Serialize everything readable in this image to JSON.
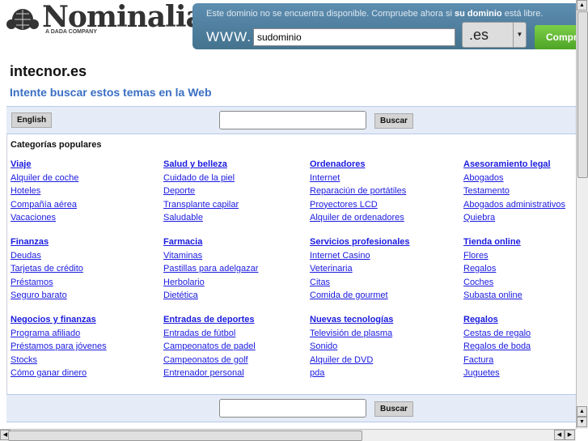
{
  "logo": {
    "name": "Nominalia",
    "tagline": "A DADA COMPANY"
  },
  "domain_box": {
    "message": "Este dominio no se encuentra disponible. Compruebe ahora si ",
    "message_bold": "su dominio",
    "message_end": " está libre.",
    "prefix": "WWW.",
    "input_value": "sudominio",
    "tld": ".es",
    "check_button": "Comprobar"
  },
  "page": {
    "title": "intecnor.es",
    "subtitle": "Intente buscar estos temas en la Web"
  },
  "search": {
    "language_button": "English",
    "search_button": "Buscar"
  },
  "categories": {
    "heading": "Categorías populares",
    "columns": [
      [
        {
          "title": "Viaje",
          "items": [
            "Alquiler de coche",
            "Hoteles",
            "Compañía aérea",
            "Vacaciones"
          ]
        },
        {
          "title": "Finanzas",
          "items": [
            "Deudas",
            "Tarjetas de crédito",
            "Préstamos",
            "Seguro barato"
          ]
        },
        {
          "title": "Negocios y finanzas",
          "items": [
            "Programa afiliado",
            "Préstamos para jóvenes",
            "Stocks",
            "Cómo ganar dinero"
          ]
        }
      ],
      [
        {
          "title": "Salud y belleza",
          "items": [
            "Cuidado de la piel",
            "Deporte",
            "Transplante capilar",
            "Saludable"
          ]
        },
        {
          "title": "Farmacia",
          "items": [
            "Vitaminas",
            "Pastillas para adelgazar",
            "Herbolario",
            "Dietética"
          ]
        },
        {
          "title": "Entradas de deportes",
          "items": [
            "Entradas de fútbol",
            "Campeonatos de padel",
            "Campeonatos de golf",
            "Entrenador personal"
          ]
        }
      ],
      [
        {
          "title": "Ordenadores",
          "items": [
            "Internet",
            "Reparaciún de portátiles",
            "Proyectores LCD",
            "Alquiler de ordenadores"
          ]
        },
        {
          "title": "Servicios profesionales",
          "items": [
            "Internet Casino",
            "Veterinaria",
            "Citas",
            "Comida de gourmet"
          ]
        },
        {
          "title": "Nuevas tecnologías",
          "items": [
            "Televisión de plasma",
            "Sonido",
            "Alquiler de DVD",
            "pda"
          ]
        }
      ],
      [
        {
          "title": "Asesoramiento legal",
          "items": [
            "Abogados",
            "Testamento",
            "Abogados administrativos",
            "Quiebra"
          ]
        },
        {
          "title": "Tienda online",
          "items": [
            "Flores",
            "Regalos",
            "Coches",
            "Subasta online"
          ]
        },
        {
          "title": "Regalos",
          "items": [
            "Cestas de regalo",
            "Regalos de boda",
            "Factura",
            "Juguetes"
          ]
        }
      ]
    ]
  }
}
